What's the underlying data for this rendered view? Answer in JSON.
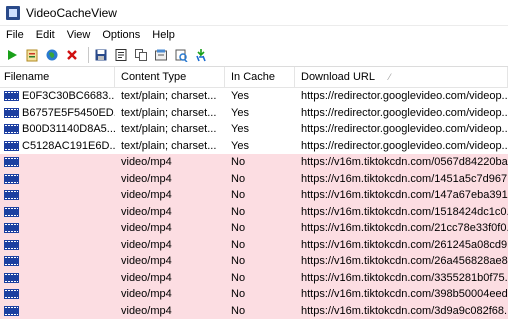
{
  "window": {
    "title": "VideoCacheView"
  },
  "menu": [
    "File",
    "Edit",
    "View",
    "Options",
    "Help"
  ],
  "toolbar": {
    "icons": [
      "play-icon",
      "open-file-icon",
      "globe-icon",
      "delete-icon",
      "save-icon",
      "properties-icon",
      "copy-icon",
      "html-report-icon",
      "refresh-icon",
      "exit-icon"
    ]
  },
  "columns": [
    "Filename",
    "Content Type",
    "In Cache",
    "Download URL"
  ],
  "sort_indicator": "⁄",
  "rows": [
    {
      "filename": "E0F3C30BC6683...",
      "content_type": "text/plain; charset...",
      "in_cache": "Yes",
      "url": "https://redirector.googlevideo.com/videop...",
      "highlight": false
    },
    {
      "filename": "B6757E5F5450ED...",
      "content_type": "text/plain; charset...",
      "in_cache": "Yes",
      "url": "https://redirector.googlevideo.com/videop...",
      "highlight": false
    },
    {
      "filename": "B00D31140D8A5...",
      "content_type": "text/plain; charset...",
      "in_cache": "Yes",
      "url": "https://redirector.googlevideo.com/videop...",
      "highlight": false
    },
    {
      "filename": "C5128AC191E6D...",
      "content_type": "text/plain; charset...",
      "in_cache": "Yes",
      "url": "https://redirector.googlevideo.com/videop...",
      "highlight": false
    },
    {
      "filename": "",
      "content_type": "video/mp4",
      "in_cache": "No",
      "url": "https://v16m.tiktokcdn.com/0567d84220ba...",
      "highlight": true
    },
    {
      "filename": "",
      "content_type": "video/mp4",
      "in_cache": "No",
      "url": "https://v16m.tiktokcdn.com/1451a5c7d967...",
      "highlight": true
    },
    {
      "filename": "",
      "content_type": "video/mp4",
      "in_cache": "No",
      "url": "https://v16m.tiktokcdn.com/147a67eba391...",
      "highlight": true
    },
    {
      "filename": "",
      "content_type": "video/mp4",
      "in_cache": "No",
      "url": "https://v16m.tiktokcdn.com/1518424dc1c0...",
      "highlight": true
    },
    {
      "filename": "",
      "content_type": "video/mp4",
      "in_cache": "No",
      "url": "https://v16m.tiktokcdn.com/21cc78e33f0f0...",
      "highlight": true
    },
    {
      "filename": "",
      "content_type": "video/mp4",
      "in_cache": "No",
      "url": "https://v16m.tiktokcdn.com/261245a08cd9...",
      "highlight": true
    },
    {
      "filename": "",
      "content_type": "video/mp4",
      "in_cache": "No",
      "url": "https://v16m.tiktokcdn.com/26a456828ae8...",
      "highlight": true
    },
    {
      "filename": "",
      "content_type": "video/mp4",
      "in_cache": "No",
      "url": "https://v16m.tiktokcdn.com/3355281b0f75...",
      "highlight": true
    },
    {
      "filename": "",
      "content_type": "video/mp4",
      "in_cache": "No",
      "url": "https://v16m.tiktokcdn.com/398b50004eed...",
      "highlight": true
    },
    {
      "filename": "",
      "content_type": "video/mp4",
      "in_cache": "No",
      "url": "https://v16m.tiktokcdn.com/3d9a9c082f68...",
      "highlight": true
    }
  ],
  "colors": {
    "highlight_row": "#fcdde2",
    "file_icon": "#1c3fa0"
  }
}
